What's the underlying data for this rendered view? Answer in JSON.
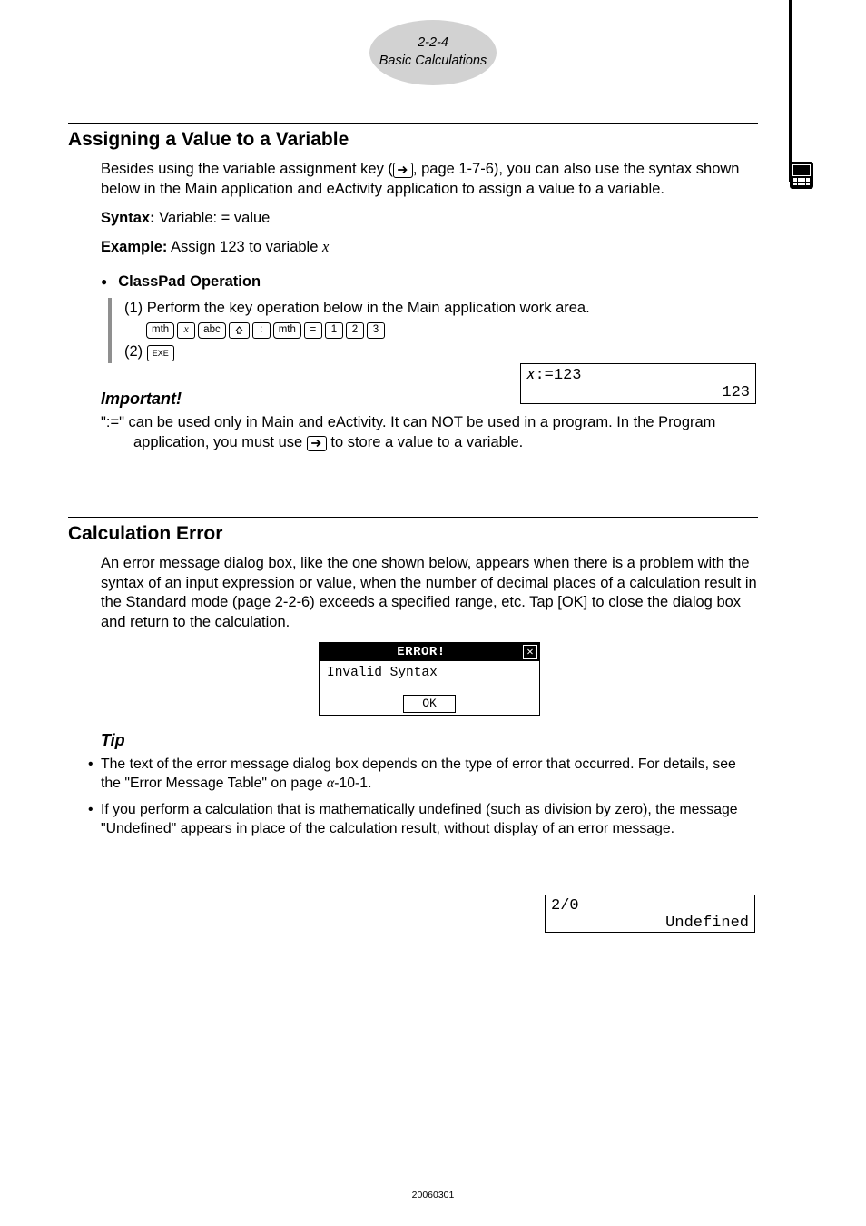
{
  "header": {
    "line1": "2-2-4",
    "line2": "Basic Calculations"
  },
  "section_assign": {
    "title": "Assigning a Value to a Variable",
    "intro_a": "Besides using the variable assignment key (",
    "intro_b": ", page 1-7-6), you can also use the syntax shown below in the Main application and eActivity application to assign a value to a variable.",
    "syntax_label": "Syntax:",
    "syntax_text": " Variable: = value",
    "example_label": "Example:",
    "example_text_a": " Assign 123 to variable ",
    "example_var": "x",
    "classpad_heading": "ClassPad Operation",
    "step1": "(1) Perform the key operation below in the Main application work area.",
    "step2": "(2) ",
    "keys": {
      "mth": "mth",
      "x": "x",
      "abc": "abc",
      "shift": "↑",
      "colon": ":",
      "eq": "=",
      "k1": "1",
      "k2": "2",
      "k3": "3",
      "exe": "EXE"
    },
    "lcd1": {
      "input": "𝑥:=123",
      "output": "123"
    },
    "important_heading": "Important!",
    "important_a": "\":=\" can be used only in Main and eActivity. It can NOT be used in a program. In the Program application, you must use ",
    "important_b": " to store a value to a variable."
  },
  "section_error": {
    "title": "Calculation Error",
    "intro": "An error message dialog box, like the one shown below, appears when there is a problem with the syntax of an input expression or value, when the number of decimal places of a calculation result in the Standard mode (page 2-2-6) exceeds a specified range, etc. Tap [OK] to close the dialog box and return to the calculation.",
    "dialog": {
      "title": "ERROR!",
      "message": "Invalid Syntax",
      "ok": "OK"
    },
    "tip_heading": "Tip",
    "tip1_a": "The text of the error message dialog box depends on the type of error that occurred. For details, see the \"Error Message Table\" on page ",
    "tip1_alpha": "α",
    "tip1_b": "-10-1.",
    "tip2": "If you perform a calculation that is mathematically undefined (such as division by zero), the message \"Undefined\" appears in place of the calculation result, without display of an error message.",
    "lcd2": {
      "input": "2/0",
      "output": "Undefined"
    }
  },
  "footer": "20060301"
}
